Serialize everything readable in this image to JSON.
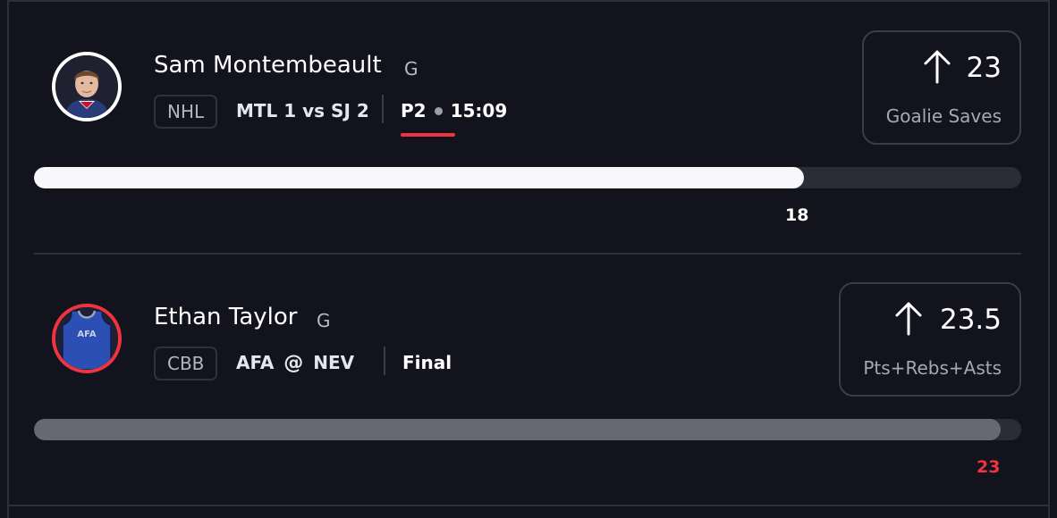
{
  "cards": [
    {
      "player_name": "Sam Montembeault",
      "position": "G",
      "league": "NHL",
      "matchup": "MTL 1 vs SJ 2",
      "period": "P2",
      "clock": "15:09",
      "direction_icon": "arrow-up-icon",
      "line": "23",
      "stat_label": "Goalie Saves",
      "current_value": "18",
      "progress_fraction": 0.78,
      "bar_color": "#f8f8fb",
      "value_color": "#ffffff"
    },
    {
      "player_name": "Ethan Taylor",
      "position": "G",
      "league": "CBB",
      "matchup_away": "AFA",
      "matchup_sep": "@",
      "matchup_home": "NEV",
      "status": "Final",
      "direction_icon": "arrow-up-icon",
      "line": "23.5",
      "stat_label": "Pts+Rebs+Asts",
      "current_value": "23",
      "progress_fraction": 0.979,
      "bar_color": "#676873",
      "value_color": "#ef3340"
    }
  ],
  "colors": {
    "accent_red": "#ef3340",
    "background": "#12131c"
  },
  "jersey_text": "AFA"
}
